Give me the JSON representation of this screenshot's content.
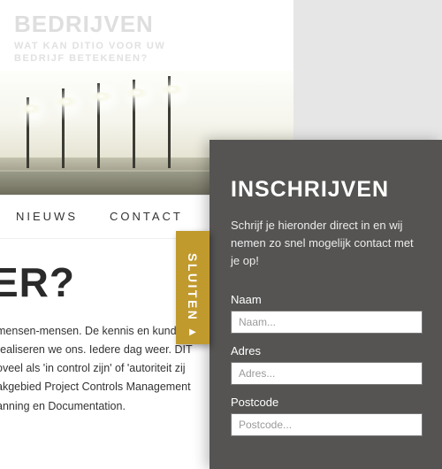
{
  "header": {
    "logo": "BEDRIJVEN",
    "tagline_line1": "WAT KAN DITIO VOOR UW",
    "tagline_line2": "BEDRIJF BETEKENEN?"
  },
  "nav": {
    "items": [
      "NIEUWS",
      "CONTACT"
    ]
  },
  "page": {
    "heading": "ER?",
    "body": "mensen-mensen. De kennis en kunde v\n realiseren we ons. Iedere dag weer. DIT\noveel als 'in control zijn' of 'autoriteit zij\nakgebied Project Controls Management\nanning en Documentation."
  },
  "close_tab": {
    "label": "SLUITEN"
  },
  "panel": {
    "title": "INSCHRIJVEN",
    "intro": "Schrijf je hieronder direct in en wij nemen zo snel mogelijk contact met je op!",
    "fields": [
      {
        "label": "Naam",
        "placeholder": "Naam..."
      },
      {
        "label": "Adres",
        "placeholder": "Adres..."
      },
      {
        "label": "Postcode",
        "placeholder": "Postcode..."
      }
    ]
  }
}
